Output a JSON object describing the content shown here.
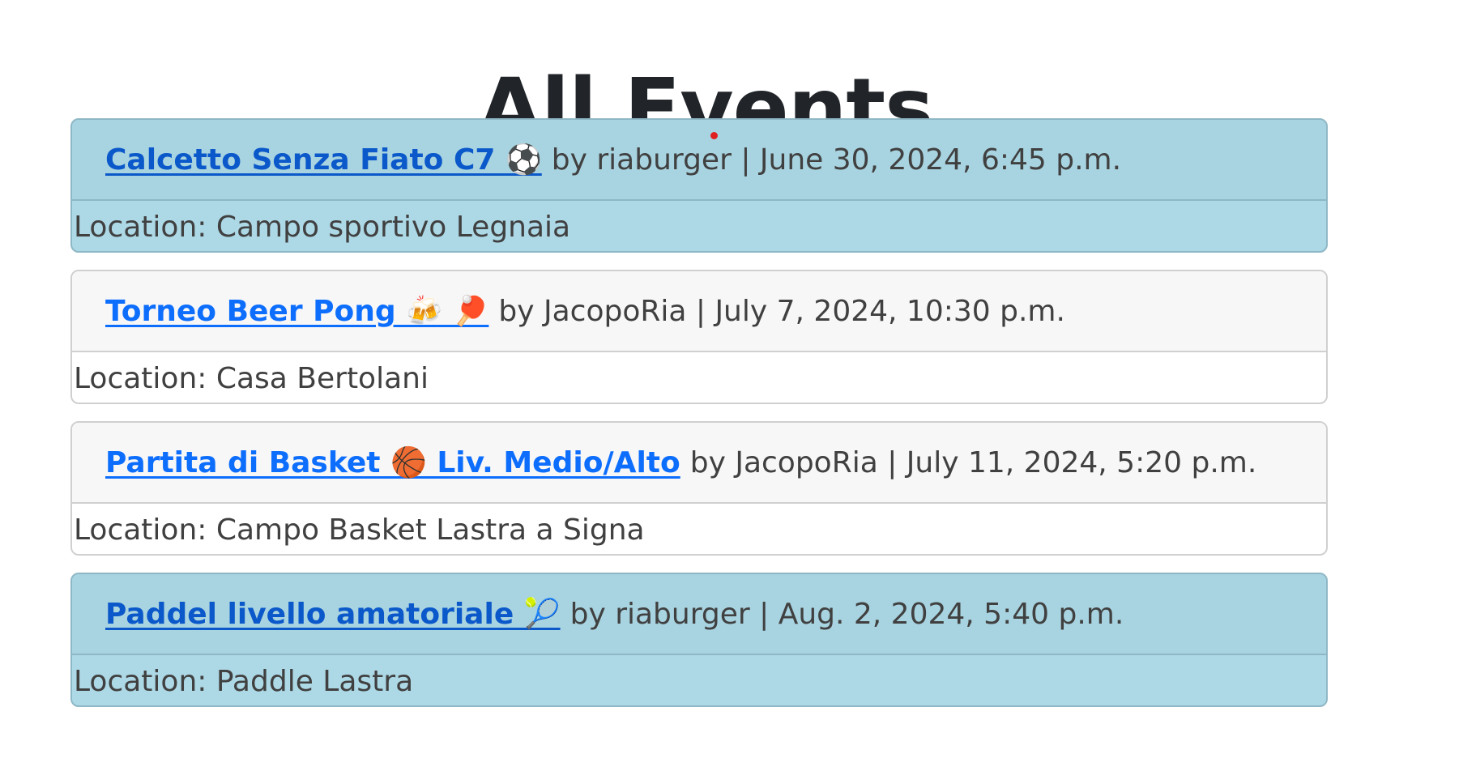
{
  "page": {
    "title": "All Events"
  },
  "events": [
    {
      "title": "Calcetto Senza Fiato C7 ⚽",
      "meta": "by riaburger | June 30, 2024, 6:45 p.m.",
      "location": "Location: Campo sportivo Legnaia",
      "highlighted": true
    },
    {
      "title": "Torneo Beer Pong 🍻 🏓",
      "meta": "by JacopoRia | July 7, 2024, 10:30 p.m.",
      "location": "Location: Casa Bertolani",
      "highlighted": false
    },
    {
      "title": "Partita di Basket 🏀 Liv. Medio/Alto",
      "meta": "by JacopoRia | July 11, 2024, 5:20 p.m.",
      "location": "Location: Campo Basket Lastra a Signa",
      "highlighted": false
    },
    {
      "title": "Paddel livello amatoriale 🎾",
      "meta": "by riaburger | Aug. 2, 2024, 5:40 p.m.",
      "location": "Location: Paddle Lastra",
      "highlighted": true
    }
  ],
  "colors": {
    "link": "#0d6efd",
    "highlight_bg": "#add8e6",
    "text": "#404040",
    "title": "#212529"
  }
}
